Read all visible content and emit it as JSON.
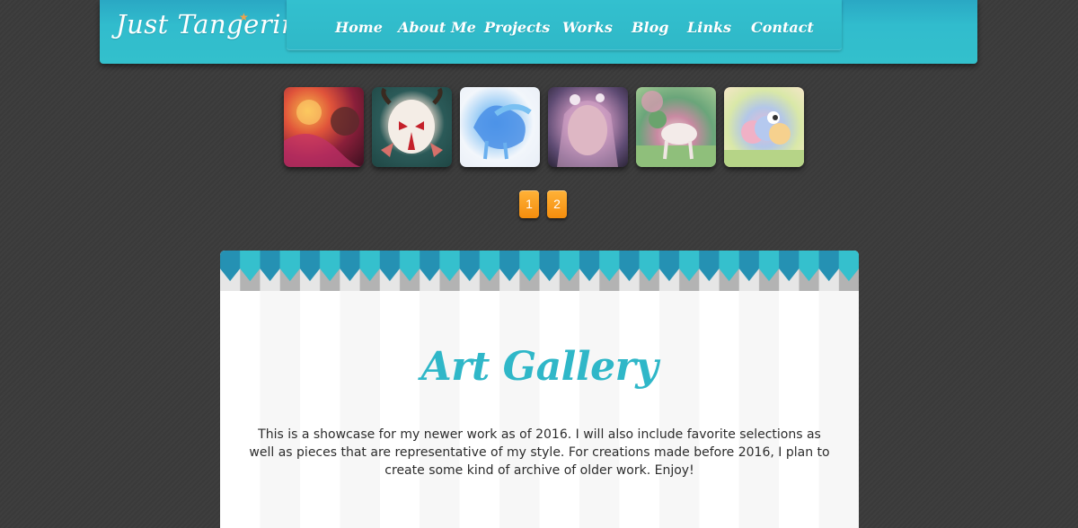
{
  "site": {
    "logo": "Just Tangerine"
  },
  "nav": {
    "items": [
      {
        "label": "Home"
      },
      {
        "label": "About Me"
      },
      {
        "label": "Projects"
      },
      {
        "label": "Works"
      },
      {
        "label": "Blog"
      },
      {
        "label": "Links"
      },
      {
        "label": "Contact"
      }
    ]
  },
  "gallery": {
    "thumbnails": [
      {
        "name": "artwork-1"
      },
      {
        "name": "artwork-2"
      },
      {
        "name": "artwork-3"
      },
      {
        "name": "artwork-4"
      },
      {
        "name": "artwork-5"
      },
      {
        "name": "artwork-6"
      }
    ],
    "pages": [
      "1",
      "2"
    ],
    "title": "Art Gallery",
    "description": "This is a showcase for my newer work as of 2016. I will also include favorite selections as well as pieces that are representative of my style. For creations made before 2016, I plan to create some kind of archive of older work. Enjoy!"
  },
  "colors": {
    "accent": "#31bccd",
    "page_button": "#f48d0d",
    "background": "#3b3b3b",
    "title": "#2fb7c8"
  }
}
